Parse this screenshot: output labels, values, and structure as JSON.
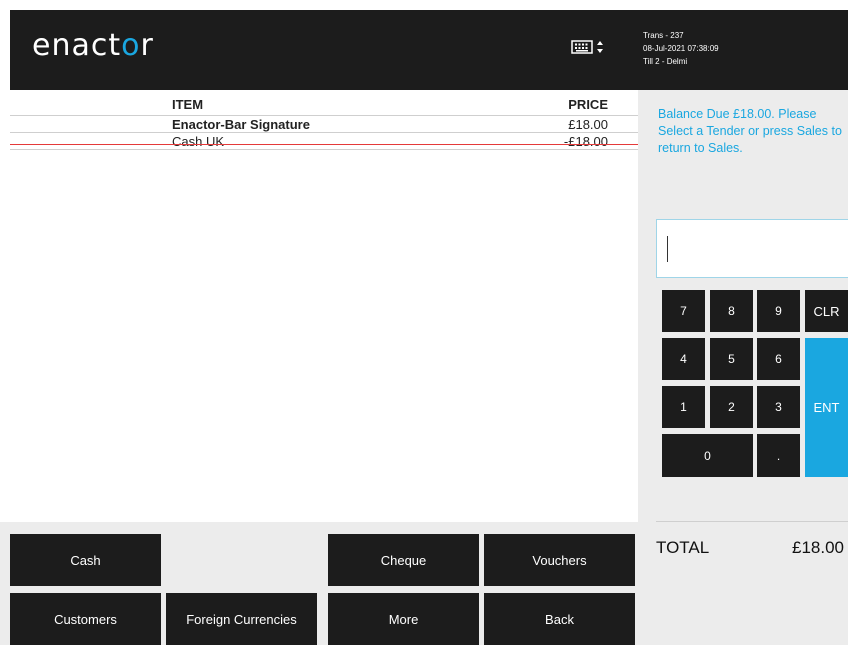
{
  "header": {
    "logo_text": "enactor",
    "keyboard_icon": "keyboard-icon",
    "trans": "Trans - 237",
    "datetime": "08-Jul-2021 07:38:09",
    "till": "Till 2 - Delmi"
  },
  "basket": {
    "item_header": "ITEM",
    "price_header": "PRICE",
    "rows": [
      {
        "name": "Enactor-Bar Signature",
        "price": "£18.00"
      },
      {
        "name": "Cash UK",
        "price": "-£18.00"
      }
    ]
  },
  "side": {
    "prompt": "Balance Due £18.00. Please Select a Tender or press Sales to return to Sales.",
    "entry_value": "",
    "keys": {
      "k7": "7",
      "k8": "8",
      "k9": "9",
      "clr": "CLR",
      "k4": "4",
      "k5": "5",
      "k6": "6",
      "k1": "1",
      "k2": "2",
      "k3": "3",
      "ent": "ENT",
      "k0": "0",
      "dot": "."
    },
    "total_label": "TOTAL",
    "total_value": "£18.00"
  },
  "tenders": {
    "cash": "Cash",
    "cheque": "Cheque",
    "vouchers": "Vouchers",
    "customers": "Customers",
    "foreign": "Foreign Currencies",
    "more": "More",
    "back": "Back"
  },
  "colors": {
    "accent": "#1aa7e0",
    "dark": "#1c1c1c",
    "void_line": "#e53a3a"
  }
}
